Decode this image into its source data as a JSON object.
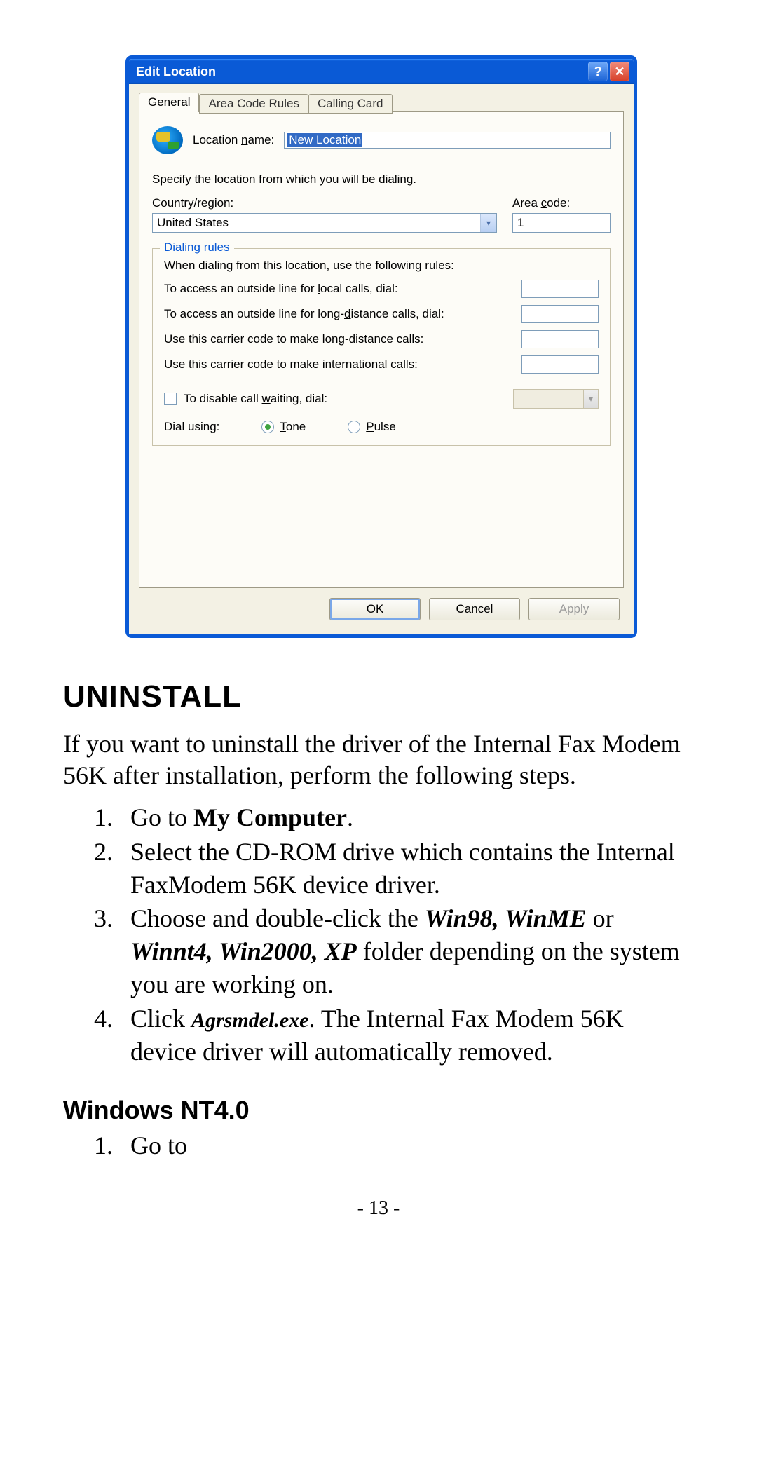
{
  "dialog": {
    "title": "Edit Location",
    "tabs": [
      "General",
      "Area Code Rules",
      "Calling Card"
    ],
    "location_name_label": "Location name:",
    "location_name_value": "New Location",
    "specify_text": "Specify the location from which you will be dialing.",
    "country_label": "Country/region:",
    "country_value": "United States",
    "area_code_label": "Area code:",
    "area_code_value": "1",
    "dialing_rules_legend": "Dialing rules",
    "rules_intro": "When dialing from this location, use the following rules:",
    "rule_local": "To access an outside line for local calls, dial:",
    "rule_long": "To access an outside line for long-distance calls, dial:",
    "rule_carrier_long": "Use this carrier code to make long-distance calls:",
    "rule_carrier_intl": "Use this carrier code to make international calls:",
    "call_waiting_label": "To disable call waiting, dial:",
    "dial_using_label": "Dial using:",
    "tone_label": "Tone",
    "pulse_label": "Pulse",
    "ok": "OK",
    "cancel": "Cancel",
    "apply": "Apply"
  },
  "doc": {
    "uninstall_heading": "UNINSTALL",
    "uninstall_para": "If you want to uninstall the driver of the Internal Fax Modem 56K after installation, perform the following steps.",
    "step1_a": "Go to ",
    "step1_b": "My Computer",
    "step1_c": ".",
    "step2": "Select the CD-ROM drive which contains the Internal FaxModem 56K device driver.",
    "step3_a": "Choose and double-click the ",
    "step3_b": "Win98, WinME",
    "step3_c": " or ",
    "step3_d": "Winnt4, Win2000, XP",
    "step3_e": " folder depending on the system you are working on.",
    "step4_a": "Click ",
    "step4_b": "Agrsmdel.exe",
    "step4_c": ".    The Internal Fax Modem 56K device driver will automatically removed.",
    "nt_heading": "Windows NT4.0",
    "nt_step1": "Go to",
    "page_num": "- 13 -"
  }
}
